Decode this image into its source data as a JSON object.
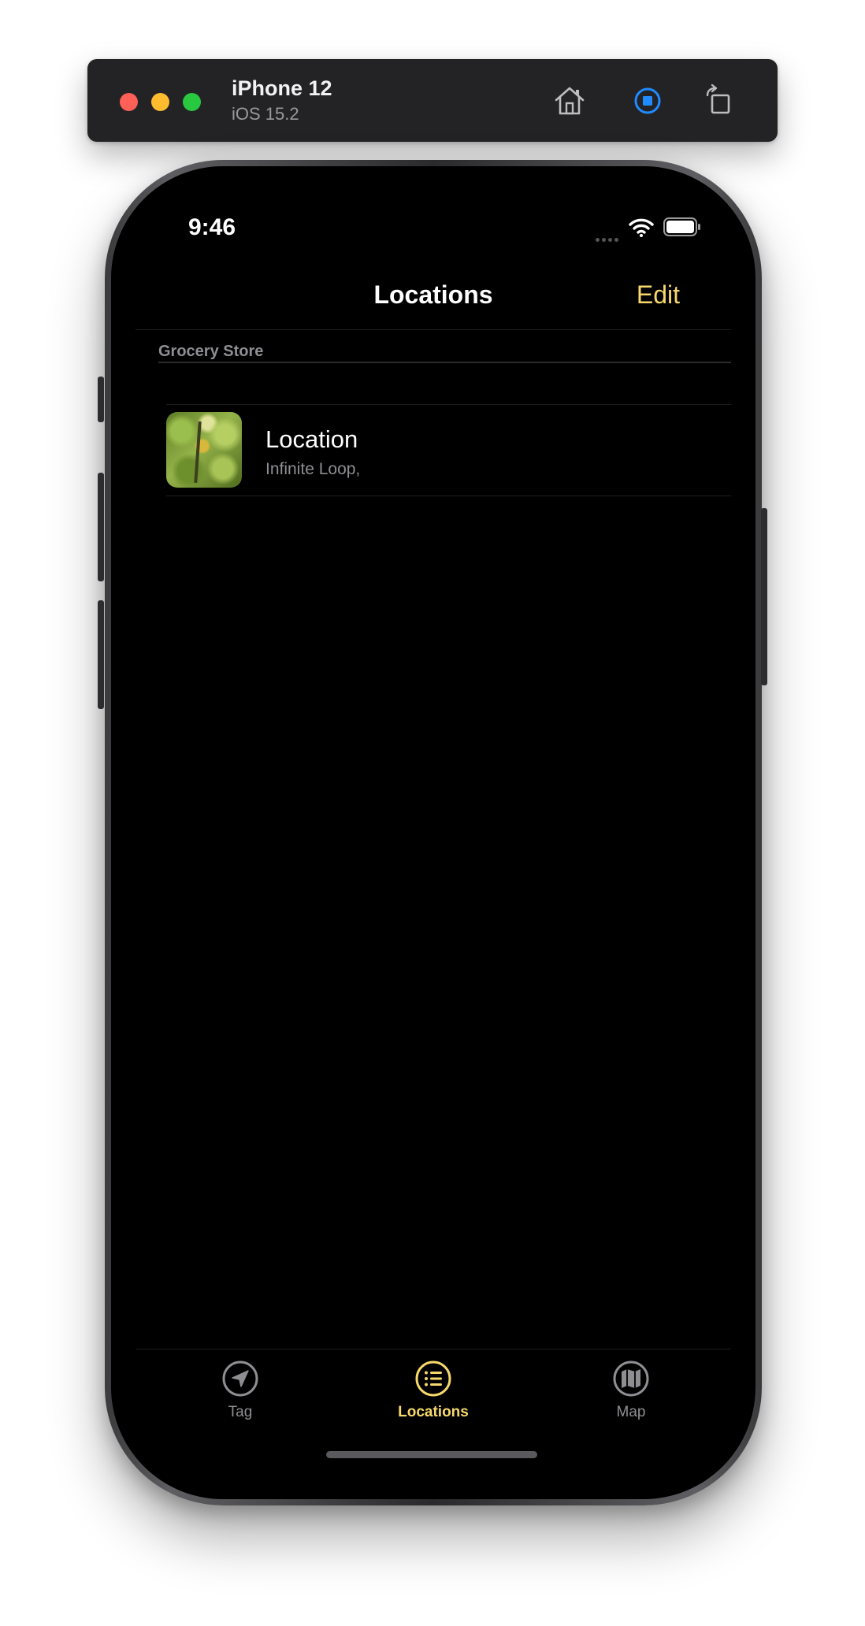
{
  "simulator": {
    "device_name": "iPhone 12",
    "os_version": "iOS 15.2",
    "toolbar_icons": [
      "home-icon",
      "stop-record-icon",
      "rotate-icon"
    ]
  },
  "status_bar": {
    "time": "9:46",
    "icons": [
      "signal-icon",
      "wifi-icon",
      "battery-icon"
    ]
  },
  "nav": {
    "title": "Locations",
    "edit_label": "Edit"
  },
  "sections": [
    {
      "header": "Grocery Store",
      "rows": [
        {
          "title": "Location",
          "subtitle": "Infinite Loop,",
          "thumbnail": "leaf-photo"
        }
      ]
    }
  ],
  "tabs": [
    {
      "label": "Tag",
      "icon": "location-arrow-icon",
      "active": false
    },
    {
      "label": "Locations",
      "icon": "list-icon",
      "active": true
    },
    {
      "label": "Map",
      "icon": "map-icon",
      "active": false
    }
  ],
  "colors": {
    "accent": "#f6d86c",
    "inactive": "#8e8e93",
    "background": "#000000"
  }
}
